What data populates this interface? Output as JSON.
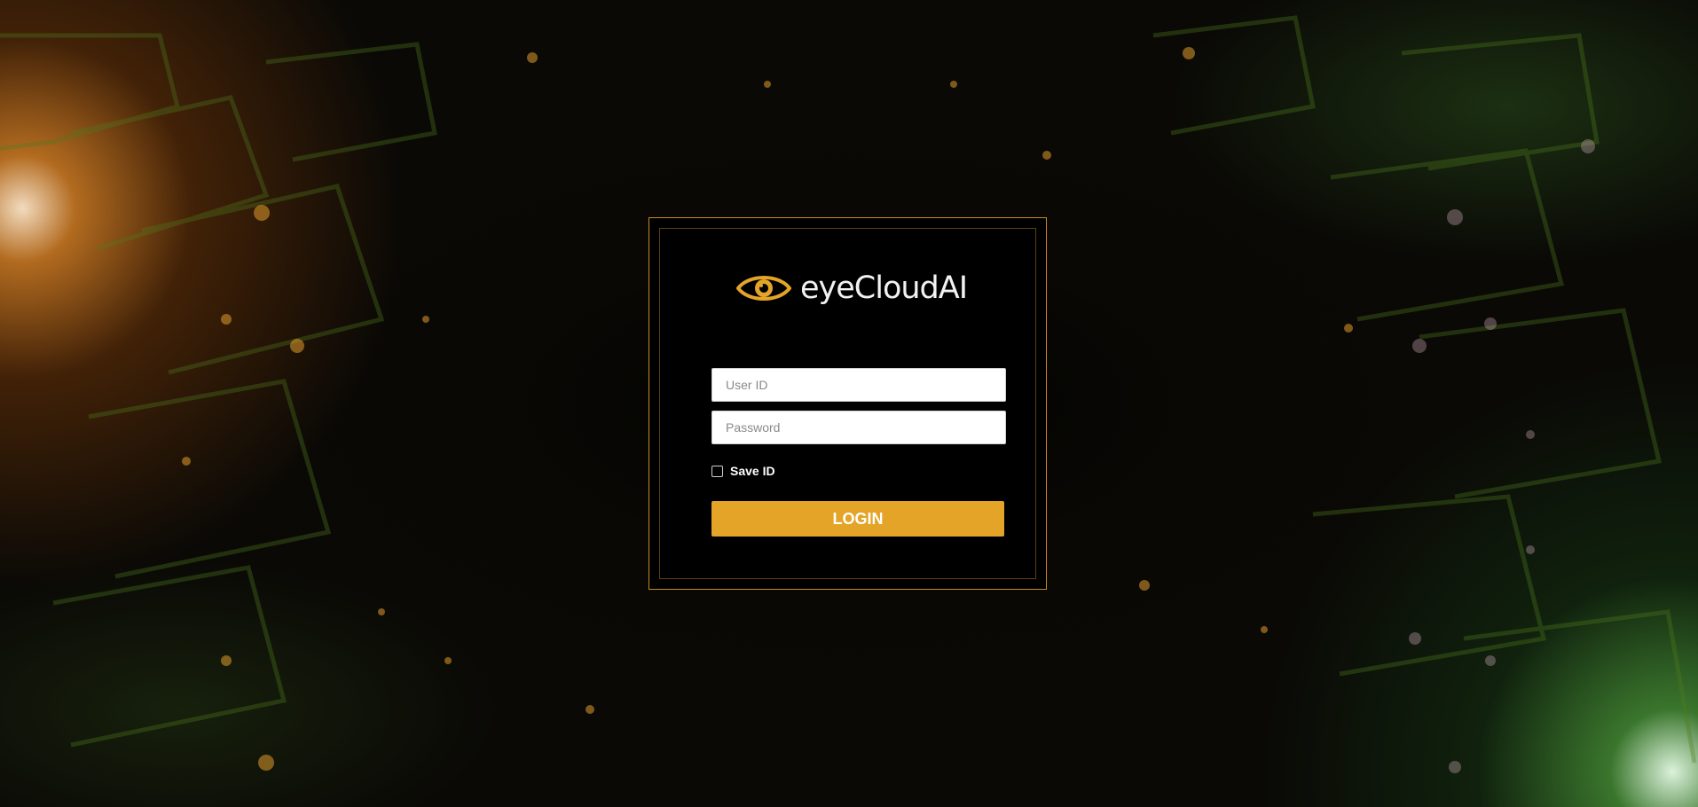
{
  "brand": {
    "logo_text": "eyeCloudAI",
    "logo_icon": "eye-icon",
    "accent_color": "#e3a428"
  },
  "login_form": {
    "user_id_placeholder": "User ID",
    "user_id_value": "",
    "password_placeholder": "Password",
    "password_value": "",
    "save_id_label": "Save ID",
    "save_id_checked": false,
    "login_button_label": "LOGIN"
  }
}
